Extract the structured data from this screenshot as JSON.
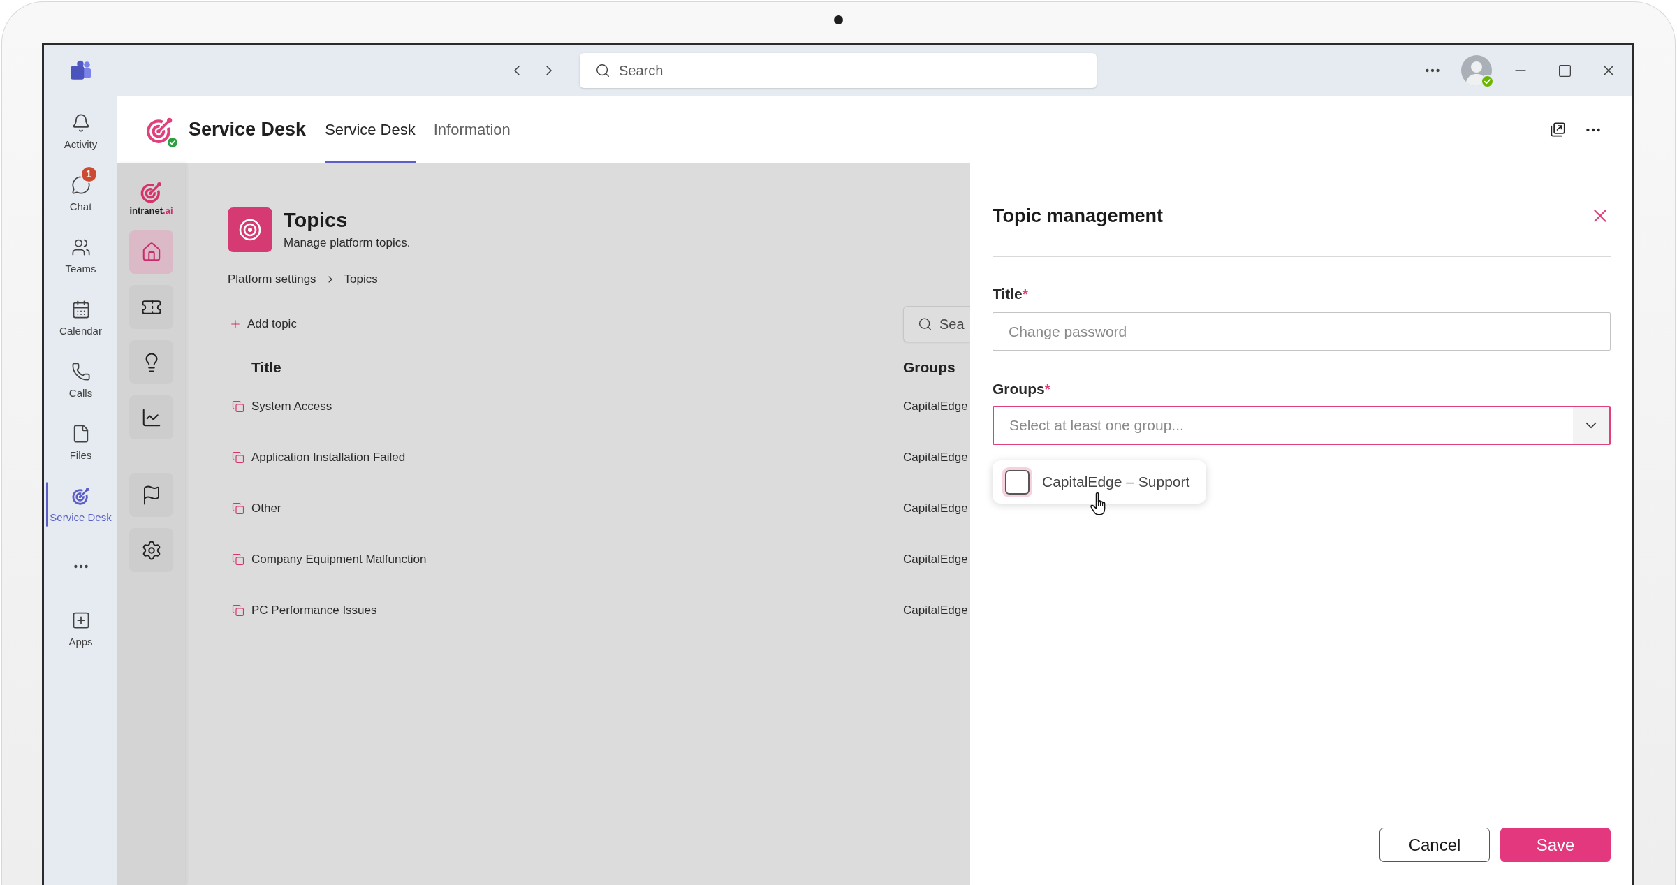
{
  "title_bar": {
    "search": {
      "placeholder": "Search"
    },
    "user": {
      "available": true
    }
  },
  "rail": {
    "items": [
      {
        "label": "Activity",
        "selected": false
      },
      {
        "label": "Chat",
        "selected": false,
        "badge": "1"
      },
      {
        "label": "Teams",
        "selected": false
      },
      {
        "label": "Calendar",
        "selected": false
      },
      {
        "label": "Calls",
        "selected": false
      },
      {
        "label": "Files",
        "selected": false
      },
      {
        "label": "Service Desk",
        "selected": true
      }
    ],
    "apps": {
      "label": "Apps"
    }
  },
  "app_header": {
    "title": "Service Desk",
    "tabs": [
      {
        "label": "Service Desk",
        "selected": true
      },
      {
        "label": "Information",
        "selected": false
      }
    ]
  },
  "side_nav": {
    "brand": "intranet.ai",
    "sections": [
      {
        "items": [
          {
            "selected": true
          },
          {
            "selected": false
          },
          {
            "selected": false
          },
          {
            "selected": false
          }
        ]
      },
      {
        "items": [
          {
            "selected": false
          },
          {
            "selected": false
          }
        ]
      }
    ]
  },
  "page": {
    "title": "Topics",
    "subtitle": "Manage platform topics.",
    "breadcrumb": [
      "Platform settings",
      "Topics"
    ],
    "add_button": "Add topic",
    "search": {
      "placeholder": "Sea"
    }
  },
  "table": {
    "columns": [
      "Title",
      "Groups"
    ],
    "rows": [
      {
        "title": "System Access",
        "groups": "CapitalEdge"
      },
      {
        "title": "Application Installation Failed",
        "groups": "CapitalEdge"
      },
      {
        "title": "Other",
        "groups": "CapitalEdge"
      },
      {
        "title": "Company Equipment Malfunction",
        "groups": "CapitalEdge"
      },
      {
        "title": "PC Performance Issues",
        "groups": "CapitalEdge"
      }
    ]
  },
  "panel": {
    "title": "Topic management",
    "fields": [
      {
        "kind": "text",
        "label": "Title",
        "required_mark": "*",
        "placeholder": "Change password"
      },
      {
        "kind": "select",
        "label": "Groups",
        "required_mark": "*",
        "placeholder": "Select at least one group...",
        "expanded": true,
        "options": [
          {
            "label": "CapitalEdge – Support",
            "checked": false
          }
        ]
      }
    ],
    "buttons": [
      {
        "label": "Cancel",
        "kind": "secondary"
      },
      {
        "label": "Save",
        "kind": "primary"
      }
    ]
  }
}
